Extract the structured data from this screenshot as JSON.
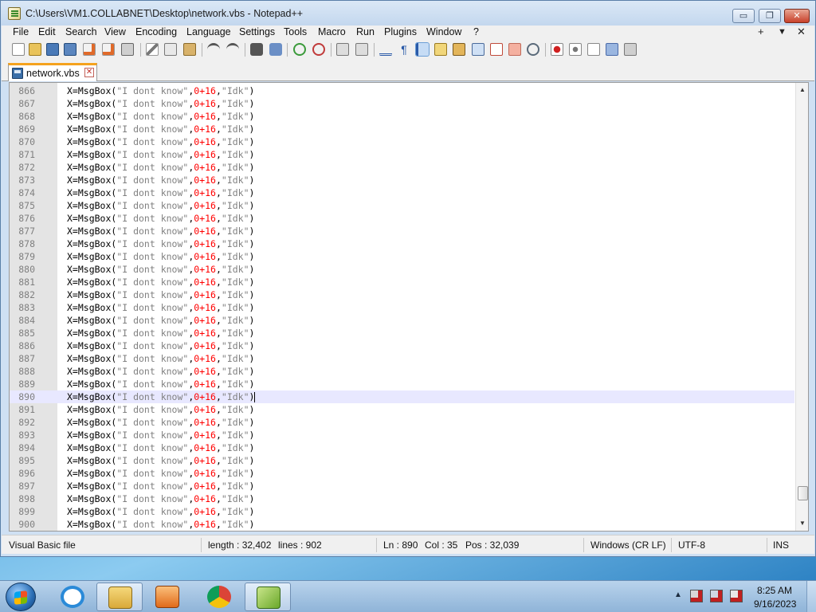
{
  "window": {
    "title": "C:\\Users\\VM1.COLLABNET\\Desktop\\network.vbs - Notepad++",
    "min_glyph": "▭",
    "max_glyph": "❐",
    "close_glyph": "✕"
  },
  "menu": {
    "items": [
      "File",
      "Edit",
      "Search",
      "View",
      "Encoding",
      "Language",
      "Settings",
      "Tools",
      "Macro",
      "Run",
      "Plugins",
      "Window",
      "?"
    ],
    "right_plus": "+",
    "right_down": "▼",
    "right_close": "✕"
  },
  "toolbar": {
    "icons": [
      "new-file-icon",
      "open-file-icon",
      "save-icon",
      "save-all-icon",
      "close-icon",
      "close-all-icon",
      "print-icon",
      "cut-icon",
      "copy-icon",
      "paste-icon",
      "undo-icon",
      "redo-icon",
      "find-icon",
      "replace-icon",
      "zoom-in-icon",
      "zoom-out-icon",
      "sync-vertical-icon",
      "sync-horizontal-icon",
      "word-wrap-icon",
      "show-all-chars-icon",
      "indent-guide-icon",
      "udl-icon",
      "doc-map-icon",
      "function-list-icon",
      "folder-workspace-icon",
      "doc-switcher-icon",
      "monitoring-icon",
      "record-macro-icon",
      "stop-macro-icon",
      "play-macro-icon",
      "run-macro-multiple-icon",
      "save-macro-icon"
    ]
  },
  "tab": {
    "label": "network.vbs",
    "close_glyph": "✕"
  },
  "editor": {
    "current_line": 890,
    "lines": [
      {
        "n": "866",
        "code": [
          "X=MsgBox(",
          "\"I dont know\"",
          ",",
          "0+16",
          ",",
          "\"Idk\"",
          ")"
        ]
      },
      {
        "n": "867",
        "code": [
          "X=MsgBox(",
          "\"I dont know\"",
          ",",
          "0+16",
          ",",
          "\"Idk\"",
          ")"
        ]
      },
      {
        "n": "868",
        "code": [
          "X=MsgBox(",
          "\"I dont know\"",
          ",",
          "0+16",
          ",",
          "\"Idk\"",
          ")"
        ]
      },
      {
        "n": "869",
        "code": [
          "X=MsgBox(",
          "\"I dont know\"",
          ",",
          "0+16",
          ",",
          "\"Idk\"",
          ")"
        ]
      },
      {
        "n": "870",
        "code": [
          "X=MsgBox(",
          "\"I dont know\"",
          ",",
          "0+16",
          ",",
          "\"Idk\"",
          ")"
        ]
      },
      {
        "n": "871",
        "code": [
          "X=MsgBox(",
          "\"I dont know\"",
          ",",
          "0+16",
          ",",
          "\"Idk\"",
          ")"
        ]
      },
      {
        "n": "872",
        "code": [
          "X=MsgBox(",
          "\"I dont know\"",
          ",",
          "0+16",
          ",",
          "\"Idk\"",
          ")"
        ]
      },
      {
        "n": "873",
        "code": [
          "X=MsgBox(",
          "\"I dont know\"",
          ",",
          "0+16",
          ",",
          "\"Idk\"",
          ")"
        ]
      },
      {
        "n": "874",
        "code": [
          "X=MsgBox(",
          "\"I dont know\"",
          ",",
          "0+16",
          ",",
          "\"Idk\"",
          ")"
        ]
      },
      {
        "n": "875",
        "code": [
          "X=MsgBox(",
          "\"I dont know\"",
          ",",
          "0+16",
          ",",
          "\"Idk\"",
          ")"
        ]
      },
      {
        "n": "876",
        "code": [
          "X=MsgBox(",
          "\"I dont know\"",
          ",",
          "0+16",
          ",",
          "\"Idk\"",
          ")"
        ]
      },
      {
        "n": "877",
        "code": [
          "X=MsgBox(",
          "\"I dont know\"",
          ",",
          "0+16",
          ",",
          "\"Idk\"",
          ")"
        ]
      },
      {
        "n": "878",
        "code": [
          "X=MsgBox(",
          "\"I dont know\"",
          ",",
          "0+16",
          ",",
          "\"Idk\"",
          ")"
        ]
      },
      {
        "n": "879",
        "code": [
          "X=MsgBox(",
          "\"I dont know\"",
          ",",
          "0+16",
          ",",
          "\"Idk\"",
          ")"
        ]
      },
      {
        "n": "880",
        "code": [
          "X=MsgBox(",
          "\"I dont know\"",
          ",",
          "0+16",
          ",",
          "\"Idk\"",
          ")"
        ]
      },
      {
        "n": "881",
        "code": [
          "X=MsgBox(",
          "\"I dont know\"",
          ",",
          "0+16",
          ",",
          "\"Idk\"",
          ")"
        ]
      },
      {
        "n": "882",
        "code": [
          "X=MsgBox(",
          "\"I dont know\"",
          ",",
          "0+16",
          ",",
          "\"Idk\"",
          ")"
        ]
      },
      {
        "n": "883",
        "code": [
          "X=MsgBox(",
          "\"I dont know\"",
          ",",
          "0+16",
          ",",
          "\"Idk\"",
          ")"
        ]
      },
      {
        "n": "884",
        "code": [
          "X=MsgBox(",
          "\"I dont know\"",
          ",",
          "0+16",
          ",",
          "\"Idk\"",
          ")"
        ]
      },
      {
        "n": "885",
        "code": [
          "X=MsgBox(",
          "\"I dont know\"",
          ",",
          "0+16",
          ",",
          "\"Idk\"",
          ")"
        ]
      },
      {
        "n": "886",
        "code": [
          "X=MsgBox(",
          "\"I dont know\"",
          ",",
          "0+16",
          ",",
          "\"Idk\"",
          ")"
        ]
      },
      {
        "n": "887",
        "code": [
          "X=MsgBox(",
          "\"I dont know\"",
          ",",
          "0+16",
          ",",
          "\"Idk\"",
          ")"
        ]
      },
      {
        "n": "888",
        "code": [
          "X=MsgBox(",
          "\"I dont know\"",
          ",",
          "0+16",
          ",",
          "\"Idk\"",
          ")"
        ]
      },
      {
        "n": "889",
        "code": [
          "X=MsgBox(",
          "\"I dont know\"",
          ",",
          "0+16",
          ",",
          "\"Idk\"",
          ")"
        ]
      },
      {
        "n": "890",
        "code": [
          "X=MsgBox(",
          "\"I dont know\"",
          ",",
          "0+16",
          ",",
          "\"Idk\"",
          ")"
        ]
      },
      {
        "n": "891",
        "code": [
          "X=MsgBox(",
          "\"I dont know\"",
          ",",
          "0+16",
          ",",
          "\"Idk\"",
          ")"
        ]
      },
      {
        "n": "892",
        "code": [
          "X=MsgBox(",
          "\"I dont know\"",
          ",",
          "0+16",
          ",",
          "\"Idk\"",
          ")"
        ]
      },
      {
        "n": "893",
        "code": [
          "X=MsgBox(",
          "\"I dont know\"",
          ",",
          "0+16",
          ",",
          "\"Idk\"",
          ")"
        ]
      },
      {
        "n": "894",
        "code": [
          "X=MsgBox(",
          "\"I dont know\"",
          ",",
          "0+16",
          ",",
          "\"Idk\"",
          ")"
        ]
      },
      {
        "n": "895",
        "code": [
          "X=MsgBox(",
          "\"I dont know\"",
          ",",
          "0+16",
          ",",
          "\"Idk\"",
          ")"
        ]
      },
      {
        "n": "896",
        "code": [
          "X=MsgBox(",
          "\"I dont know\"",
          ",",
          "0+16",
          ",",
          "\"Idk\"",
          ")"
        ]
      },
      {
        "n": "897",
        "code": [
          "X=MsgBox(",
          "\"I dont know\"",
          ",",
          "0+16",
          ",",
          "\"Idk\"",
          ")"
        ]
      },
      {
        "n": "898",
        "code": [
          "X=MsgBox(",
          "\"I dont know\"",
          ",",
          "0+16",
          ",",
          "\"Idk\"",
          ")"
        ]
      },
      {
        "n": "899",
        "code": [
          "X=MsgBox(",
          "\"I dont know\"",
          ",",
          "0+16",
          ",",
          "\"Idk\"",
          ")"
        ]
      },
      {
        "n": "900",
        "code": [
          "X=MsgBox(",
          "\"I dont know\"",
          ",",
          "0+16",
          ",",
          "\"Idk\"",
          ")"
        ]
      }
    ],
    "colors": {
      "string": "#808080",
      "number": "#ff0000",
      "current_line_bg": "#e8e8ff"
    }
  },
  "statusbar": {
    "file_type": "Visual Basic file",
    "length": "length : 32,402",
    "lines": "lines : 902",
    "ln": "Ln : 890",
    "col": "Col : 35",
    "pos": "Pos : 32,039",
    "eol": "Windows (CR LF)",
    "encoding": "UTF-8",
    "mode": "INS"
  },
  "taskbar": {
    "apps": [
      "internet-explorer-icon",
      "file-explorer-icon",
      "media-player-icon",
      "chrome-icon",
      "notepad-plus-plus-icon"
    ],
    "tray_up": "▲",
    "time": "8:25 AM",
    "date": "9/16/2023"
  }
}
